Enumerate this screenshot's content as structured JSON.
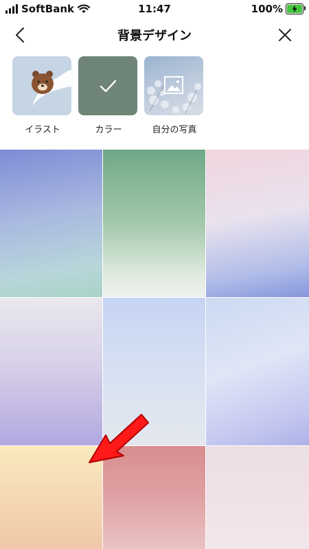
{
  "status_bar": {
    "carrier": "SoftBank",
    "time": "11:47",
    "battery_percent": "100%",
    "battery_level": 1.0,
    "battery_color": "#46c43f"
  },
  "header": {
    "title": "背景デザイン",
    "back_icon": "chevron-left-icon",
    "close_icon": "close-icon"
  },
  "options": [
    {
      "label": "イラスト",
      "icon": "bear-illustration-icon",
      "selected": false
    },
    {
      "label": "カラー",
      "icon": "checkmark-icon",
      "selected": true
    },
    {
      "label": "自分の写真",
      "icon": "image-icon",
      "selected": false
    }
  ],
  "swatch_grid": {
    "rows": 3,
    "columns": 3,
    "swatches": [
      {
        "colors": [
          "#7f8bd6",
          "#a9d3c6"
        ]
      },
      {
        "colors": [
          "#6fa987",
          "#eef0ee"
        ]
      },
      {
        "colors": [
          "#f1d5de",
          "#8596dc"
        ]
      },
      {
        "colors": [
          "#eae8ee",
          "#b3a8e0"
        ]
      },
      {
        "colors": [
          "#c5d4f3",
          "#e4e8ee"
        ]
      },
      {
        "colors": [
          "#cbd9f2",
          "#aeb1e6"
        ]
      },
      {
        "colors": [
          "#f9e9bc",
          "#f0c7a8"
        ]
      },
      {
        "colors": [
          "#d98d8f",
          "#e9c2c2"
        ]
      },
      {
        "colors": [
          "#ecdfe3",
          "#f3e6ea"
        ]
      }
    ]
  },
  "annotation": {
    "icon": "red-arrow-icon",
    "color": "#ff1a1a"
  }
}
